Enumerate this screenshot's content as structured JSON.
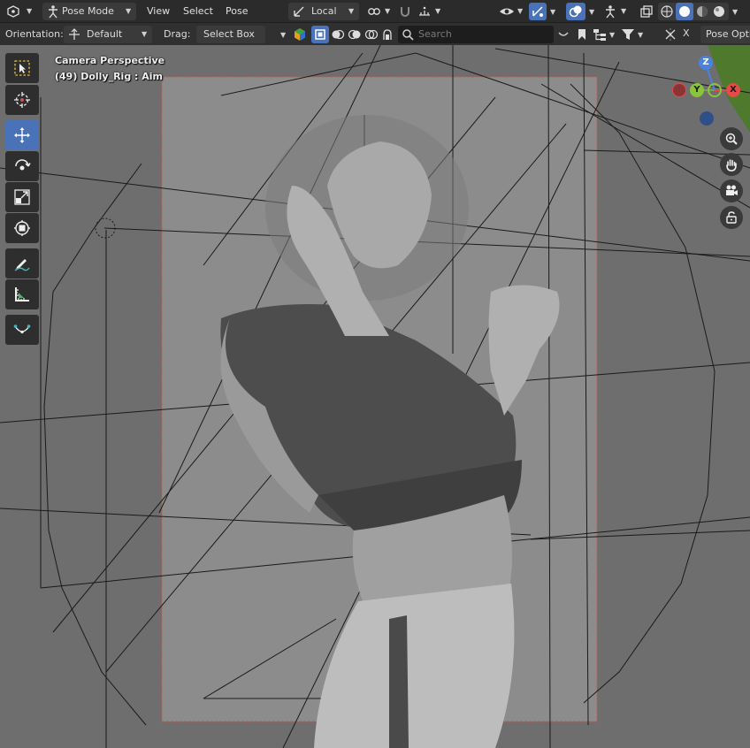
{
  "header": {
    "mode_label": "Pose Mode",
    "menus": [
      "View",
      "Select",
      "Pose"
    ],
    "transform_orientation": "Local"
  },
  "tool_options": {
    "orientation_label": "Orientation:",
    "orientation_value": "Default",
    "drag_label": "Drag:",
    "drag_value": "Select Box",
    "search_placeholder": "Search",
    "pose_options_label": "Pose Opti"
  },
  "viewport": {
    "camera_label": "Camera Perspective",
    "object_label": "(49) Dolly_Rig : Aim",
    "axes": {
      "x": "X",
      "y": "Y",
      "z": "Z"
    }
  },
  "toolbar": {
    "tools": [
      "select-box-tool",
      "cursor-tool",
      "move-tool",
      "rotate-tool",
      "scale-tool",
      "transform-tool",
      "annotate-tool",
      "measure-tool",
      "relax-tool"
    ],
    "active_tool": "move-tool"
  },
  "colors": {
    "accent": "#4a72b8",
    "header_bg": "#2b2b2b",
    "viewport_bg": "#6f6f6f",
    "axis_x": "#e34a4a",
    "axis_y": "#8ac43a",
    "axis_z": "#4a82e0"
  }
}
